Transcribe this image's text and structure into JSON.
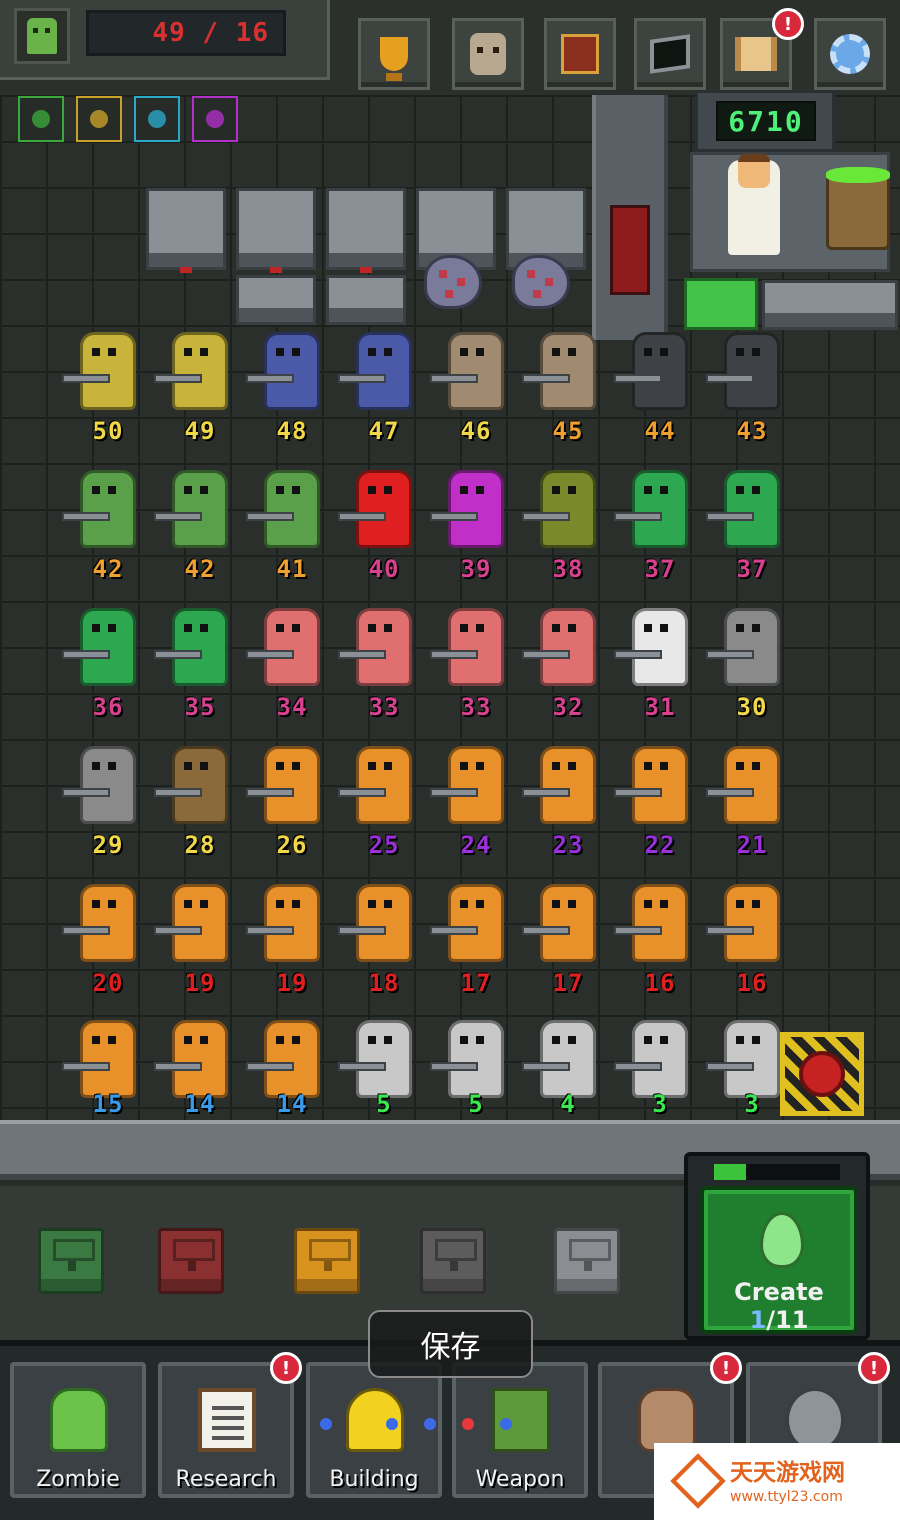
{
  "header": {
    "capacity_text": "49 / 16",
    "top_buttons": [
      {
        "icon": "trophy-icon",
        "alert": false
      },
      {
        "icon": "zombie-head-icon",
        "alert": false
      },
      {
        "icon": "book-icon",
        "alert": false
      },
      {
        "icon": "terminal-icon",
        "alert": false
      },
      {
        "icon": "scroll-icon",
        "alert": true
      },
      {
        "icon": "gear-icon",
        "alert": false
      }
    ],
    "alert_symbol": "!"
  },
  "upgrades": [
    {
      "icon": "flask-upgrade-icon",
      "color": "#3aa83a"
    },
    {
      "icon": "coin-upgrade-icon",
      "color": "#c8a02a"
    },
    {
      "icon": "potion-upgrade-icon",
      "color": "#2aa8c8"
    },
    {
      "icon": "recycle-upgrade-icon",
      "color": "#b030c8"
    }
  ],
  "lab": {
    "counter_value": "6710"
  },
  "creatures": {
    "rows": [
      [
        {
          "level": "50",
          "color": "#c8b43a",
          "label_color": "#f0d848"
        },
        {
          "level": "49",
          "color": "#c8b43a",
          "label_color": "#f0d848"
        },
        {
          "level": "48",
          "color": "#4a5aa8",
          "label_color": "#f0d848"
        },
        {
          "level": "47",
          "color": "#4a5aa8",
          "label_color": "#f0d848"
        },
        {
          "level": "46",
          "color": "#a08a70",
          "label_color": "#f0d848"
        },
        {
          "level": "45",
          "color": "#a08a70",
          "label_color": "#f0a030"
        },
        {
          "level": "44",
          "color": "#3e4246",
          "label_color": "#f0a030"
        },
        {
          "level": "43",
          "color": "#3e4246",
          "label_color": "#f0a030"
        }
      ],
      [
        {
          "level": "42",
          "color": "#5aa04a",
          "label_color": "#f0a030"
        },
        {
          "level": "42",
          "color": "#5aa04a",
          "label_color": "#f0a030"
        },
        {
          "level": "41",
          "color": "#5aa04a",
          "label_color": "#f0a030"
        },
        {
          "level": "40",
          "color": "#e02020",
          "label_color": "#d84090"
        },
        {
          "level": "39",
          "color": "#c030c8",
          "label_color": "#d84090"
        },
        {
          "level": "38",
          "color": "#7a8a2a",
          "label_color": "#d84090"
        },
        {
          "level": "37",
          "color": "#2ea850",
          "label_color": "#d84090"
        },
        {
          "level": "37",
          "color": "#2ea850",
          "label_color": "#d84090"
        }
      ],
      [
        {
          "level": "36",
          "color": "#2ea850",
          "label_color": "#d84090"
        },
        {
          "level": "35",
          "color": "#2ea850",
          "label_color": "#d84090"
        },
        {
          "level": "34",
          "color": "#e07070",
          "label_color": "#d84090"
        },
        {
          "level": "33",
          "color": "#e07070",
          "label_color": "#d84090"
        },
        {
          "level": "33",
          "color": "#e07070",
          "label_color": "#d84090"
        },
        {
          "level": "32",
          "color": "#e07070",
          "label_color": "#d84090"
        },
        {
          "level": "31",
          "color": "#e8e8e8",
          "label_color": "#d84090"
        },
        {
          "level": "30",
          "color": "#8a8a8a",
          "label_color": "#f0d848"
        }
      ],
      [
        {
          "level": "29",
          "color": "#8a8a8a",
          "label_color": "#f0d848"
        },
        {
          "level": "28",
          "color": "#8a6a3a",
          "label_color": "#f0d848"
        },
        {
          "level": "26",
          "color": "#e8902a",
          "label_color": "#f0d848"
        },
        {
          "level": "25",
          "color": "#e8902a",
          "label_color": "#9a30d8"
        },
        {
          "level": "24",
          "color": "#e8902a",
          "label_color": "#9a30d8"
        },
        {
          "level": "23",
          "color": "#e8902a",
          "label_color": "#9a30d8"
        },
        {
          "level": "22",
          "color": "#e8902a",
          "label_color": "#9a30d8"
        },
        {
          "level": "21",
          "color": "#e8902a",
          "label_color": "#9a30d8"
        }
      ],
      [
        {
          "level": "20",
          "color": "#e8902a",
          "label_color": "#e02020"
        },
        {
          "level": "19",
          "color": "#e8902a",
          "label_color": "#e02020"
        },
        {
          "level": "19",
          "color": "#e8902a",
          "label_color": "#e02020"
        },
        {
          "level": "18",
          "color": "#e8902a",
          "label_color": "#e02020"
        },
        {
          "level": "17",
          "color": "#e8902a",
          "label_color": "#e02020"
        },
        {
          "level": "17",
          "color": "#e8902a",
          "label_color": "#e02020"
        },
        {
          "level": "16",
          "color": "#e8902a",
          "label_color": "#e02020"
        },
        {
          "level": "16",
          "color": "#e8902a",
          "label_color": "#e02020"
        }
      ],
      [
        {
          "level": "15",
          "color": "#e8902a",
          "label_color": "#3a9ae8"
        },
        {
          "level": "14",
          "color": "#e8902a",
          "label_color": "#3a9ae8"
        },
        {
          "level": "14",
          "color": "#e8902a",
          "label_color": "#3a9ae8"
        },
        {
          "level": "5",
          "color": "#c8c8c8",
          "label_color": "#3ae850"
        },
        {
          "level": "5",
          "color": "#c8c8c8",
          "label_color": "#3ae850"
        },
        {
          "level": "4",
          "color": "#c8c8c8",
          "label_color": "#3ae850"
        },
        {
          "level": "3",
          "color": "#c8c8c8",
          "label_color": "#3ae850"
        },
        {
          "level": "3",
          "color": "#c8c8c8",
          "label_color": "#3ae850"
        }
      ]
    ]
  },
  "chests": [
    {
      "color": "#3a7a42"
    },
    {
      "color": "#8a3030"
    },
    {
      "color": "#d8921e"
    },
    {
      "color": "#5c5c5c"
    },
    {
      "color": "#8a8e92"
    }
  ],
  "create": {
    "label": "Create",
    "current": "1",
    "total": "/11",
    "progress": 0.25
  },
  "tabs": [
    {
      "label": "Zombie",
      "icon": "zombie-hand-icon",
      "alert": false
    },
    {
      "label": "Research",
      "icon": "clipboard-icon",
      "alert": true
    },
    {
      "label": "Building",
      "icon": "hardhat-icon",
      "alert": false
    },
    {
      "label": "Weapon",
      "icon": "tank-icon",
      "alert": false
    },
    {
      "label": "S",
      "icon": "sack-icon",
      "alert": true
    },
    {
      "label": "",
      "icon": "gasmask-icon",
      "alert": true
    }
  ],
  "toast": {
    "text": "保存"
  },
  "watermark": {
    "title": "天天游戏网",
    "url": "www.ttyl23.com"
  }
}
